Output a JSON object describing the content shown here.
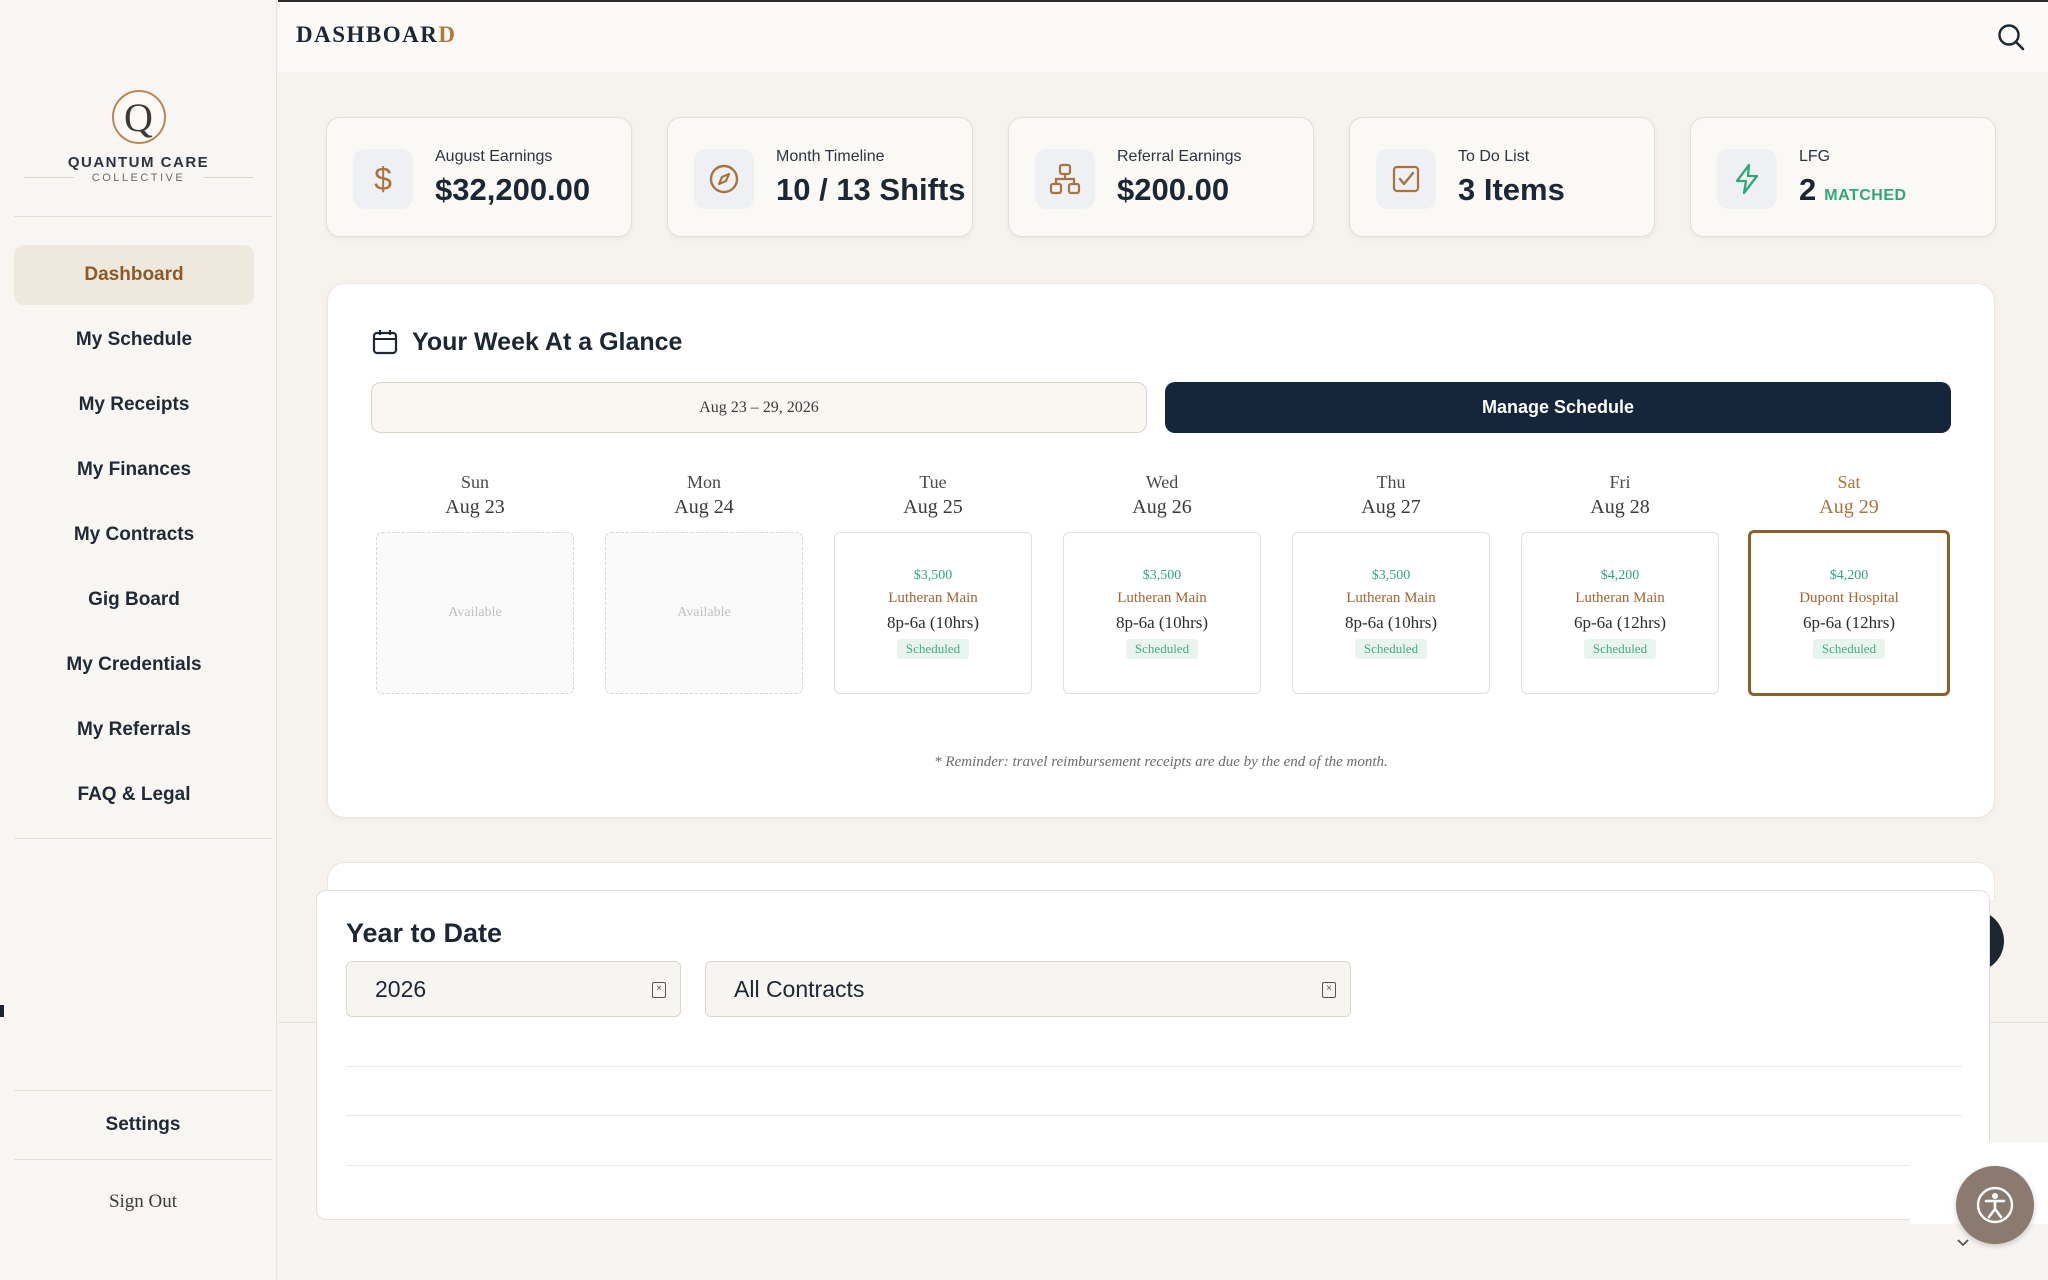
{
  "header": {
    "title_main": "DASHBOAR",
    "title_last": "D"
  },
  "brand": {
    "logo_letter": "Q",
    "name": "QUANTUM CARE",
    "sub": "COLLECTIVE"
  },
  "sidebar": {
    "items": [
      {
        "label": "Dashboard"
      },
      {
        "label": "My Schedule"
      },
      {
        "label": "My Receipts"
      },
      {
        "label": "My Finances"
      },
      {
        "label": "My Contracts"
      },
      {
        "label": "Gig Board"
      },
      {
        "label": "My Credentials"
      },
      {
        "label": "My Referrals"
      },
      {
        "label": "FAQ & Legal"
      }
    ],
    "settings": "Settings",
    "signout": "Sign Out"
  },
  "stats": [
    {
      "label": "August Earnings",
      "value": "$32,200.00",
      "icon": "dollar-icon"
    },
    {
      "label": "Month Timeline",
      "value": "10 / 13 Shifts",
      "icon": "compass-icon"
    },
    {
      "label": "Referral Earnings",
      "value": "$200.00",
      "icon": "network-icon"
    },
    {
      "label": "To Do List",
      "value": "3 Items",
      "icon": "checkbox-icon"
    },
    {
      "label": "LFG",
      "value": "2",
      "extra": "MATCHED",
      "icon": "lightning-icon"
    }
  ],
  "week": {
    "title": "Your Week At a Glance",
    "range": "Aug 23 – 29, 2026",
    "manage": "Manage Schedule",
    "days": [
      {
        "name": "Sun",
        "date": "Aug 23",
        "status": "Available"
      },
      {
        "name": "Mon",
        "date": "Aug 24",
        "status": "Available"
      },
      {
        "name": "Tue",
        "date": "Aug 25",
        "pay": "$3,500",
        "location": "Lutheran Main",
        "time": "8p-6a (10hrs)",
        "status": "Scheduled"
      },
      {
        "name": "Wed",
        "date": "Aug 26",
        "pay": "$3,500",
        "location": "Lutheran Main",
        "time": "8p-6a (10hrs)",
        "status": "Scheduled"
      },
      {
        "name": "Thu",
        "date": "Aug 27",
        "pay": "$3,500",
        "location": "Lutheran Main",
        "time": "8p-6a (10hrs)",
        "status": "Scheduled"
      },
      {
        "name": "Fri",
        "date": "Aug 28",
        "pay": "$4,200",
        "location": "Lutheran Main",
        "time": "6p-6a (12hrs)",
        "status": "Scheduled"
      },
      {
        "name": "Sat",
        "date": "Aug 29",
        "pay": "$4,200",
        "location": "Dupont Hospital",
        "time": "6p-6a (12hrs)",
        "status": "Scheduled"
      }
    ],
    "reminder": "* Reminder: travel reimbursement receipts are due by the end of the month."
  },
  "ytd": {
    "title": "Year to Date",
    "year": "2026",
    "contracts": "All Contracts"
  },
  "colors": {
    "accent": "#a7733f",
    "navy": "#15263a",
    "green": "#2fa77a"
  }
}
